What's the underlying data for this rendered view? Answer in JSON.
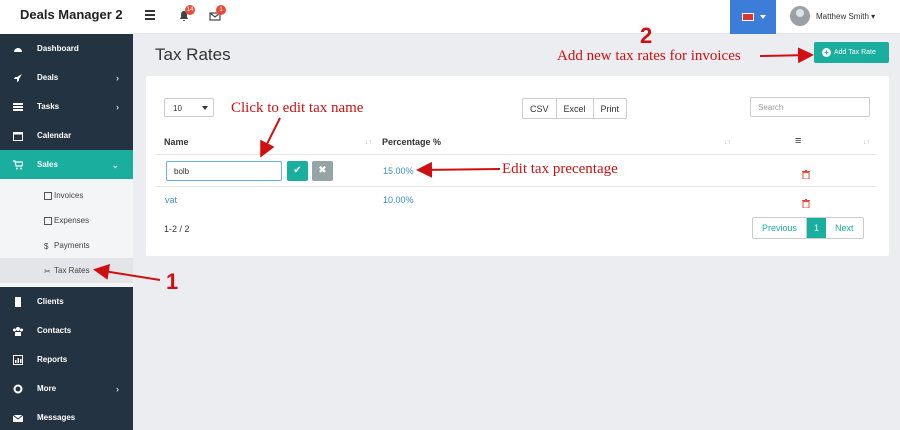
{
  "app": {
    "brand": "Deals Manager 2",
    "notifications_count": "14",
    "messages_count": "1",
    "user_name": "Matthew Smith ▾",
    "accent_color": "#1aae9f"
  },
  "sidebar": {
    "items": [
      {
        "label": "Dashboard",
        "icon": "dashboard-icon"
      },
      {
        "label": "Deals",
        "icon": "rocket-icon"
      },
      {
        "label": "Tasks",
        "icon": "list-icon"
      },
      {
        "label": "Calendar",
        "icon": "calendar-icon"
      },
      {
        "label": "Sales",
        "icon": "cart-icon"
      },
      {
        "label": "Clients",
        "icon": "building-icon"
      },
      {
        "label": "Contacts",
        "icon": "users-icon"
      },
      {
        "label": "Reports",
        "icon": "chart-icon"
      },
      {
        "label": "More",
        "icon": "gear-icon"
      },
      {
        "label": "Messages",
        "icon": "envelope-icon"
      }
    ],
    "sales_sub": [
      {
        "label": "Invoices"
      },
      {
        "label": "Expenses"
      },
      {
        "label": "Payments"
      },
      {
        "label": "Tax Rates"
      }
    ]
  },
  "page": {
    "title": "Tax Rates",
    "add_button": "Add Tax Rate"
  },
  "table": {
    "page_size": "10",
    "export_buttons": [
      "CSV",
      "Excel",
      "Print"
    ],
    "search_placeholder": "Search",
    "columns": [
      "Name",
      "Percentage %"
    ],
    "edit_value": "bolb",
    "rows": [
      {
        "name": "bolb",
        "percentage": "15.00%"
      },
      {
        "name": "vat",
        "percentage": "10.00%"
      }
    ],
    "summary": "1-2 / 2",
    "pagination": {
      "previous": "Previous",
      "current": "1",
      "next": "Next"
    }
  },
  "annotations": {
    "click_edit": "Click to edit tax  name",
    "edit_percentage": "Edit tax precentage",
    "add_new": "Add new tax rates for invoices",
    "marker_1": "1",
    "marker_2": "2"
  }
}
